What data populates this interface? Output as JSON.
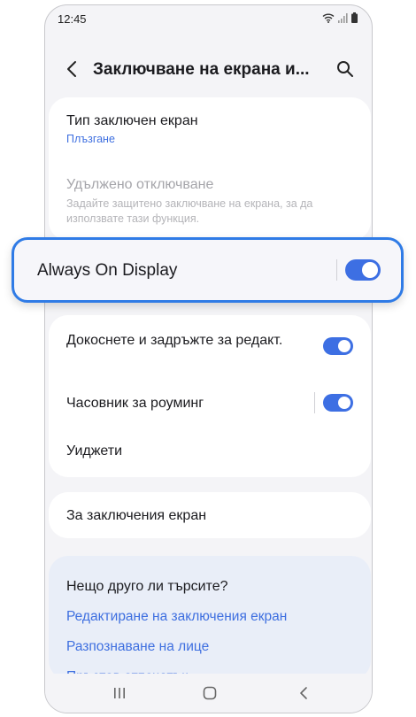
{
  "status_bar": {
    "time": "12:45"
  },
  "header": {
    "title": "Заключване на екрана и..."
  },
  "lock_section": {
    "screen_lock_type": {
      "title": "Тип заключен екран",
      "value": "Плъзгане"
    },
    "extend_unlock": {
      "title": "Удължено отключване",
      "subtitle": "Задайте защитено заключване на екрана, за да използвате тази функция."
    }
  },
  "always_on_display": {
    "label": "Always On Display",
    "enabled": true
  },
  "lock_options": {
    "touch_hold_edit": {
      "label": "Докоснете и задръжте за редакт.",
      "enabled": true
    },
    "roaming_clock": {
      "label": "Часовник за роуминг",
      "enabled": true
    },
    "widgets": {
      "label": "Уиджети"
    }
  },
  "about": {
    "label": "За заключения екран"
  },
  "suggestions": {
    "heading": "Нещо друго ли търсите?",
    "links": [
      "Редактиране на заключения екран",
      "Разпознаване на лице",
      "Пръстов отпечатък"
    ]
  },
  "accent_color": "#3d6fe3",
  "highlight_color": "#2f7be6"
}
